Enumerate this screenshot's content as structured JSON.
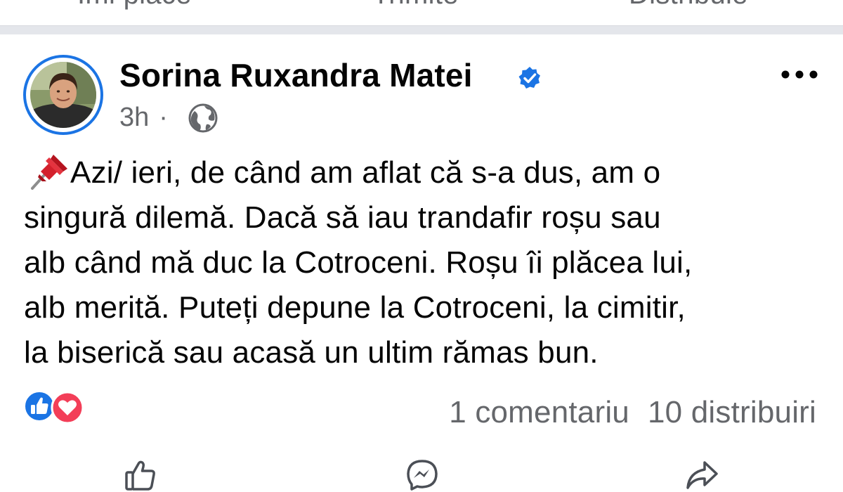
{
  "previous_post": {
    "actions": {
      "like_label": "Îmi place",
      "send_label": "Trimite",
      "share_label": "Distribuie"
    }
  },
  "post": {
    "author": {
      "name": "Sorina Ruxandra Matei",
      "verified": true,
      "avatar": "profile-photo"
    },
    "timestamp": "3h",
    "meta_separator": "·",
    "audience_icon": "globe-icon",
    "more_icon": "more-options-icon",
    "text": {
      "pin_icon": "pushpin-icon",
      "lines": [
        "Azi/ ieri, de când am aflat că s-a dus, am o",
        "singură dilemă. Dacă să iau trandafir roșu sau",
        "alb când mă duc la Cotroceni. Roșu îi plăcea lui,",
        "alb merită. Puteți depune la Cotroceni, la cimitir,",
        "la biserică sau acasă un ultim rămas bun."
      ]
    },
    "reactions": [
      "like-reaction-icon",
      "love-reaction-icon"
    ],
    "comments_label": "1 comentariu",
    "shares_label": "10 distribuiri",
    "action_icons": [
      "thumbs-up-icon",
      "messenger-icon",
      "share-arrow-icon"
    ]
  },
  "colors": {
    "facebook_blue": "#1b74e4",
    "secondary_text": "#65676b",
    "love_red": "#f33e58",
    "separator": "#e4e6eb"
  }
}
